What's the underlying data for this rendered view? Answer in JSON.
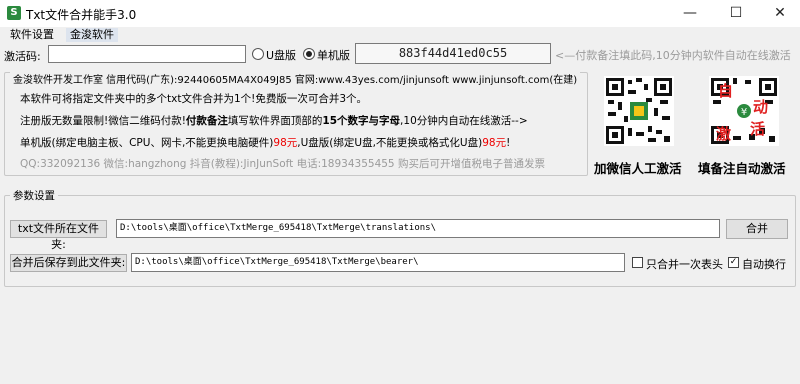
{
  "window": {
    "title": "Txt文件合并能手3.0",
    "icon_letter": "S",
    "minimize_glyph": "—",
    "maximize_glyph": "☐",
    "close_glyph": "✕"
  },
  "menu": {
    "items": [
      "软件设置",
      "金浚软件"
    ]
  },
  "activation": {
    "label": "激活码:",
    "code_value": "",
    "radio_usb": "U盘版",
    "radio_machine": "单机版",
    "selected": "单机版",
    "machine_code": "883f44d41ed0c55",
    "hint": "<—付款备注填此码,10分钟内软件自动在线激活"
  },
  "info": {
    "group_title": "金浚软件开发工作室 信用代码(广东):92440605MA4X049J85 官网:www.43yes.com/jinjunsoft  www.jinjunsoft.com(在建)",
    "line1": "本软件可将指定文件夹中的多个txt文件合并为1个!免费版一次可合并3个。",
    "line2_a": "注册版无数量限制!微信二维码付款!",
    "line2_b": "付款备注",
    "line2_c": "填写软件界面顶部的",
    "line2_d": "15个数字与字母",
    "line2_e": ",10分钟内自动在线激活-->",
    "line3_a": "单机版(绑定电脑主板、CPU、网卡,不能更换电脑硬件)",
    "line3_price1": "98元",
    "line3_b": ",U盘版(绑定U盘,不能更换或格式化U盘)",
    "line3_price2": "98元",
    "line3_c": "!",
    "line4": "QQ:332092136 微信:hangzhong 抖音(教程):JinJunSoft 电话:18934355455 购买后可开增值税电子普通发票"
  },
  "qr": {
    "left_caption": "加微信人工激活",
    "right_caption": "填备注自动激活",
    "right_overlay": [
      "自",
      "动",
      "激",
      "活"
    ]
  },
  "params": {
    "group_title": "参数设置",
    "source_label": "txt文件所在文件夹:",
    "source_path": "D:\\tools\\桌面\\office\\TxtMerge_695418\\TxtMerge\\translations\\",
    "merge_button": "合并",
    "dest_label": "合并后保存到此文件夹:",
    "dest_path": "D:\\tools\\桌面\\office\\TxtMerge_695418\\TxtMerge\\bearer\\",
    "header_once_label": "只合并一次表头",
    "header_once_checked": false,
    "auto_wrap_label": "自动换行",
    "auto_wrap_checked": true
  }
}
